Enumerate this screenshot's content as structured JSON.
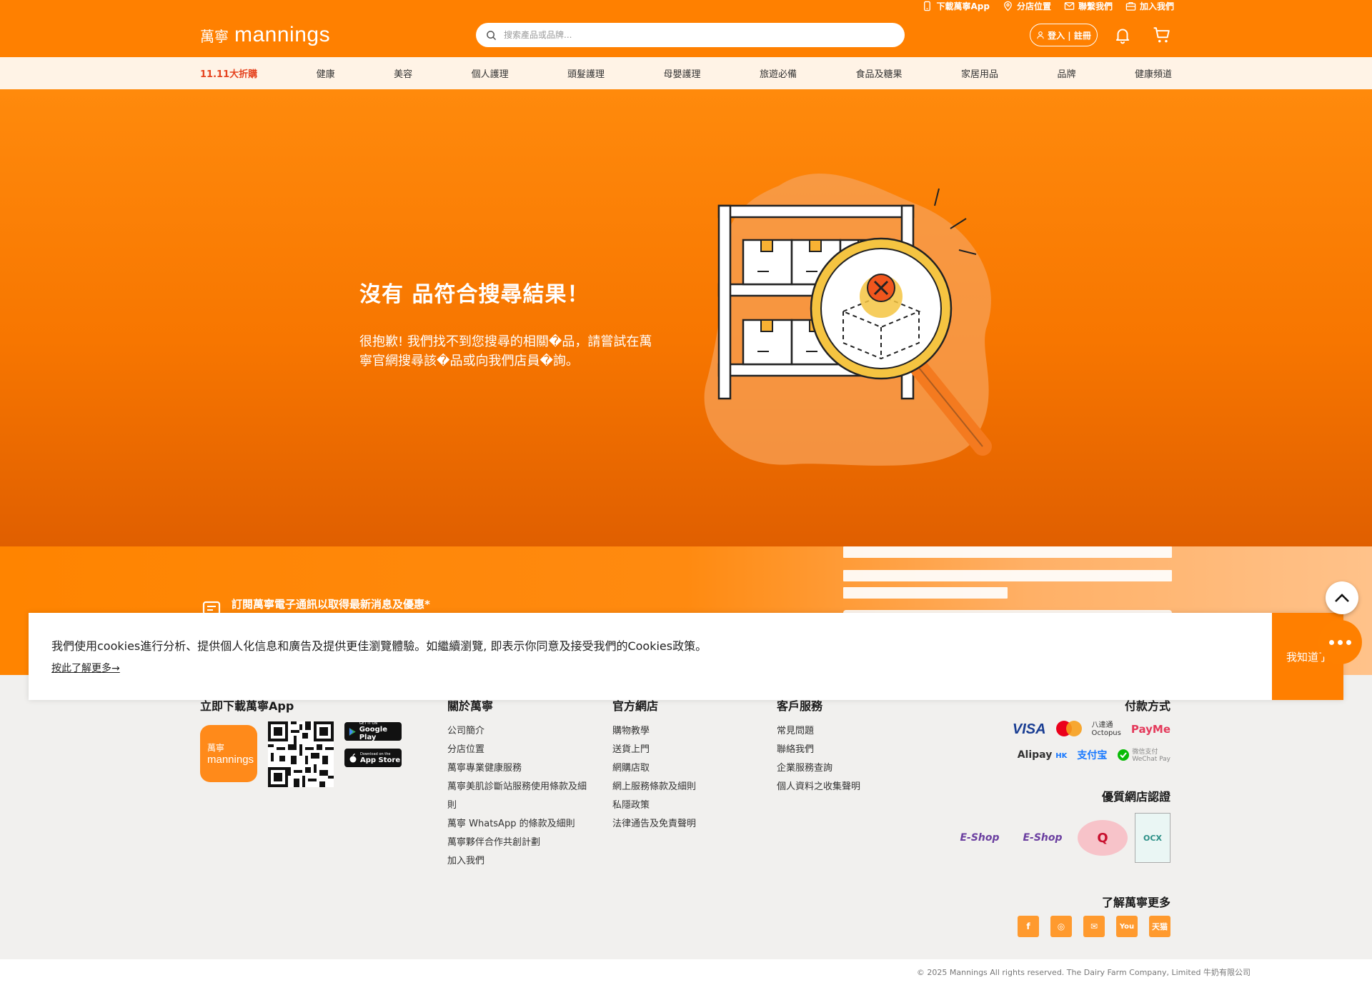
{
  "header": {
    "top_links": [
      {
        "label": "下載萬寧App",
        "icon": "mobile-icon"
      },
      {
        "label": "分店位置",
        "icon": "location-pin-icon"
      },
      {
        "label": "聯繫我們",
        "icon": "mail-icon"
      },
      {
        "label": "加入我們",
        "icon": "briefcase-icon"
      }
    ],
    "logo_cn": "萬寧",
    "logo_en": "mannings",
    "search_placeholder": "搜索產品或品牌...",
    "login_label": "登入 | 註冊"
  },
  "nav": {
    "items": [
      "11.11大折購",
      "健康",
      "美容",
      "個人護理",
      "頭髮護理",
      "母嬰護理",
      "旅遊必備",
      "食品及糖果",
      "家居用品",
      "品牌",
      "健康頻道"
    ],
    "highlight_color": "#e5431f"
  },
  "hero": {
    "title": "沒有   品符合搜尋結果！",
    "description": "很抱歉! 我們找不到您搜尋的相關�品，請嘗試在萬寧官網搜尋該�品或向我們店員�詢。"
  },
  "newsletter": {
    "title": "訂閱萬寧電子通訊以取得最新消息及優惠*"
  },
  "footer": {
    "app_heading": "立即下載萬寧App",
    "app_tile_cn": "萬寧",
    "app_tile_en": "mannings",
    "google_play": {
      "small": "GET IT ON",
      "big": "Google Play"
    },
    "app_store": {
      "small": "Download on the",
      "big": "App Store"
    },
    "about_heading": "關於萬寧",
    "about_links": [
      "公司簡介",
      "分店位置",
      "萬寧專業健康服務",
      "萬寧美肌診斷站服務使用條款及細",
      "則",
      "萬寧 WhatsApp 的條款及細則",
      "萬寧夥伴合作共創計劃",
      "加入我們"
    ],
    "eshop_heading": "官方網店",
    "eshop_links": [
      "購物教學",
      "送貨上門",
      "網購店取",
      "網上服務條款及細則",
      "私隱政策",
      "法律通告及免責聲明"
    ],
    "service_heading": "客戶服務",
    "service_links": [
      "常見問題",
      "聯絡我們",
      "企業服務查詢",
      "個人資料之收集聲明"
    ],
    "payment_heading": "付款方式",
    "payment_methods": {
      "visa": "VISA",
      "octopus_cn": "八達通",
      "octopus_en": "Octopus",
      "payme": "PayMe",
      "alipayhk": "Alipay",
      "alipayhk_suffix": "HK",
      "alipay_cn": "支付宝",
      "wechat_cn": "微信支付",
      "wechat_en": "WeChat Pay"
    },
    "cert_heading": "優質網店認證",
    "cert_badges": {
      "eshop": "E-Shop",
      "qmark": "Q",
      "ocx": "OCX"
    },
    "more_heading": "了解萬寧更多",
    "social": [
      {
        "icon": "facebook-icon",
        "label": "f"
      },
      {
        "icon": "instagram-icon",
        "label": "◎"
      },
      {
        "icon": "wechat-icon",
        "label": "✉"
      },
      {
        "icon": "youtube-icon",
        "label": "You"
      },
      {
        "icon": "tmall-icon",
        "label": "天猫"
      }
    ],
    "copyright": "© 2025 Mannings All rights reserved. The Dairy Farm Company, Limited 牛奶有限公司"
  },
  "cookie": {
    "text": "我們使用cookies進行分析、提供個人化信息和廣告及提供更佳瀏覽體驗。如繼續瀏覽, 即表示你同意及接受我們的Cookies政策。",
    "link": "按此了解更多→",
    "button": "我知道了"
  },
  "colors": {
    "brand": "#ff8000",
    "nav_bg": "#fff3e6",
    "footer_bg": "#f1f0ee"
  }
}
